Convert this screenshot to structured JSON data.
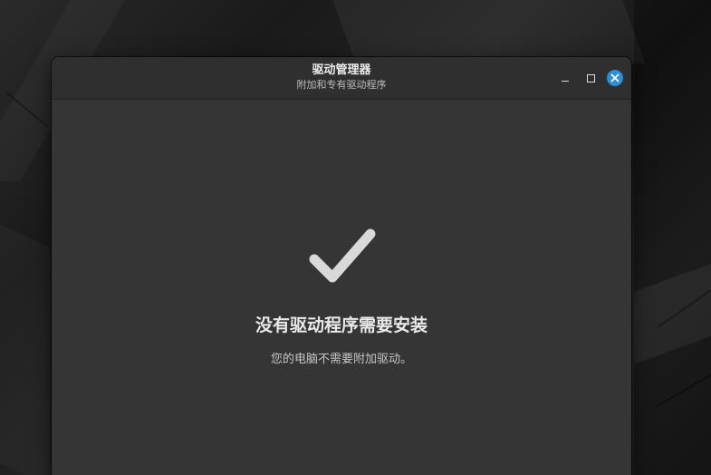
{
  "window": {
    "title": "驱动管理器",
    "subtitle": "附加和专有驱动程序"
  },
  "controls": {
    "minimize_icon": "minimize-icon",
    "maximize_icon": "maximize-icon",
    "close_icon": "close-icon",
    "close_color": "#2d8fd5"
  },
  "main": {
    "status_icon": "checkmark-icon",
    "headline": "没有驱动程序需要安装",
    "description": "您的电脑不需要附加驱动。"
  }
}
